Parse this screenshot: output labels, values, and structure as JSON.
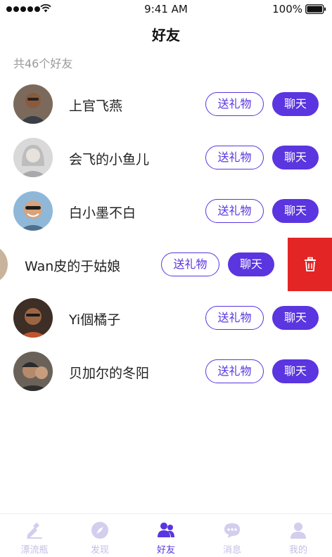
{
  "status_bar": {
    "time": "9:41 AM",
    "battery": "100%"
  },
  "header": {
    "title": "好友"
  },
  "friend_count": "共46个好友",
  "friends": [
    {
      "name": "上官飞燕",
      "gift_label": "送礼物",
      "chat_label": "聊天"
    },
    {
      "name": "会飞的小鱼儿",
      "gift_label": "送礼物",
      "chat_label": "聊天"
    },
    {
      "name": "白小墨不白",
      "gift_label": "送礼物",
      "chat_label": "聊天"
    },
    {
      "name": "Wan皮的于姑娘",
      "gift_label": "送礼物",
      "chat_label": "聊天"
    },
    {
      "name": "Yi個橘子",
      "gift_label": "送礼物",
      "chat_label": "聊天"
    },
    {
      "name": "贝加尔的冬阳",
      "gift_label": "送礼物",
      "chat_label": "聊天"
    }
  ],
  "tabs": [
    {
      "label": "漂流瓶",
      "icon": "bottle-icon",
      "active": false
    },
    {
      "label": "发现",
      "icon": "compass-icon",
      "active": false
    },
    {
      "label": "好友",
      "icon": "friends-icon",
      "active": true
    },
    {
      "label": "消息",
      "icon": "message-icon",
      "active": false
    },
    {
      "label": "我的",
      "icon": "profile-icon",
      "active": false
    }
  ],
  "colors": {
    "accent": "#5a35e0",
    "delete": "#e32525",
    "tab_inactive": "#c4bde6"
  }
}
